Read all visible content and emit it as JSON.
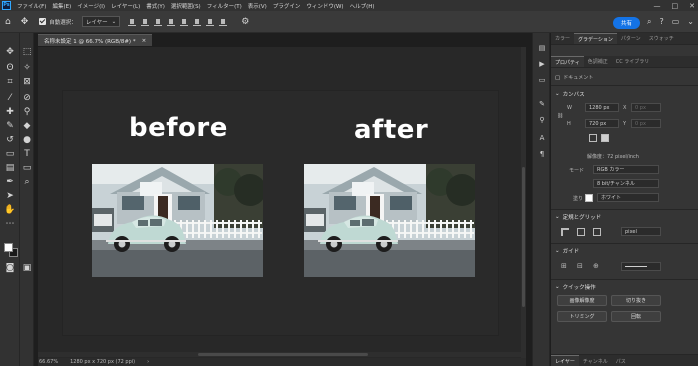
{
  "menubar": {
    "logo": "Ps",
    "items": [
      "ファイル(F)",
      "編集(E)",
      "イメージ(I)",
      "レイヤー(L)",
      "書式(Y)",
      "選択範囲(S)",
      "フィルター(T)",
      "表示(V)",
      "プラグイン",
      "ウィンドウ(W)",
      "ヘルプ(H)"
    ],
    "window_controls": [
      "—",
      "□",
      "✕"
    ]
  },
  "options": {
    "auto_select_label": "自動選択：",
    "auto_select_value": "レイヤー",
    "share_label": "共有"
  },
  "document": {
    "tab_title": "名称未設定 1 @ 66.7% (RGB/8#) *",
    "tab_close": "×",
    "label_before": "before",
    "label_after": "after"
  },
  "status": {
    "zoom": "66.67%",
    "doc_info": "1280 px x 720 px (72 ppi)"
  },
  "panel_tabs_top": [
    {
      "label": "カラー",
      "active": false
    },
    {
      "label": "グラデーション",
      "active": true
    },
    {
      "label": "パターン",
      "active": false
    },
    {
      "label": "スウォッチ",
      "active": false
    }
  ],
  "panel_tabs_props": [
    {
      "label": "プロパティ",
      "active": true
    },
    {
      "label": "色調補正",
      "active": false
    },
    {
      "label": "CC ライブラリ",
      "active": false
    }
  ],
  "properties": {
    "doc_label": "ドキュメント",
    "canvas_title": "カンバス",
    "w_label": "W",
    "w_value": "1280 px",
    "x_label": "X",
    "x_value": "0 px",
    "h_label": "H",
    "h_value": "720 px",
    "y_label": "Y",
    "y_value": "0 px",
    "resolution": "解像度：72 pixel/inch",
    "mode_label": "モード",
    "mode_value": "RGB カラー",
    "depth_value": "8 bit/チャンネル",
    "fill_label": "塗り",
    "fill_value": "ホワイト",
    "rulers_title": "定規とグリッド",
    "rulers_unit": "pixel",
    "guides_title": "ガイド",
    "quick_title": "クイック操作",
    "btn_resize": "画像解像度",
    "btn_crop": "切り抜き",
    "btn_trim": "トリミング",
    "btn_rotate": "回転"
  },
  "bottom_tabs": [
    "レイヤー",
    "チャンネル",
    "パス"
  ]
}
